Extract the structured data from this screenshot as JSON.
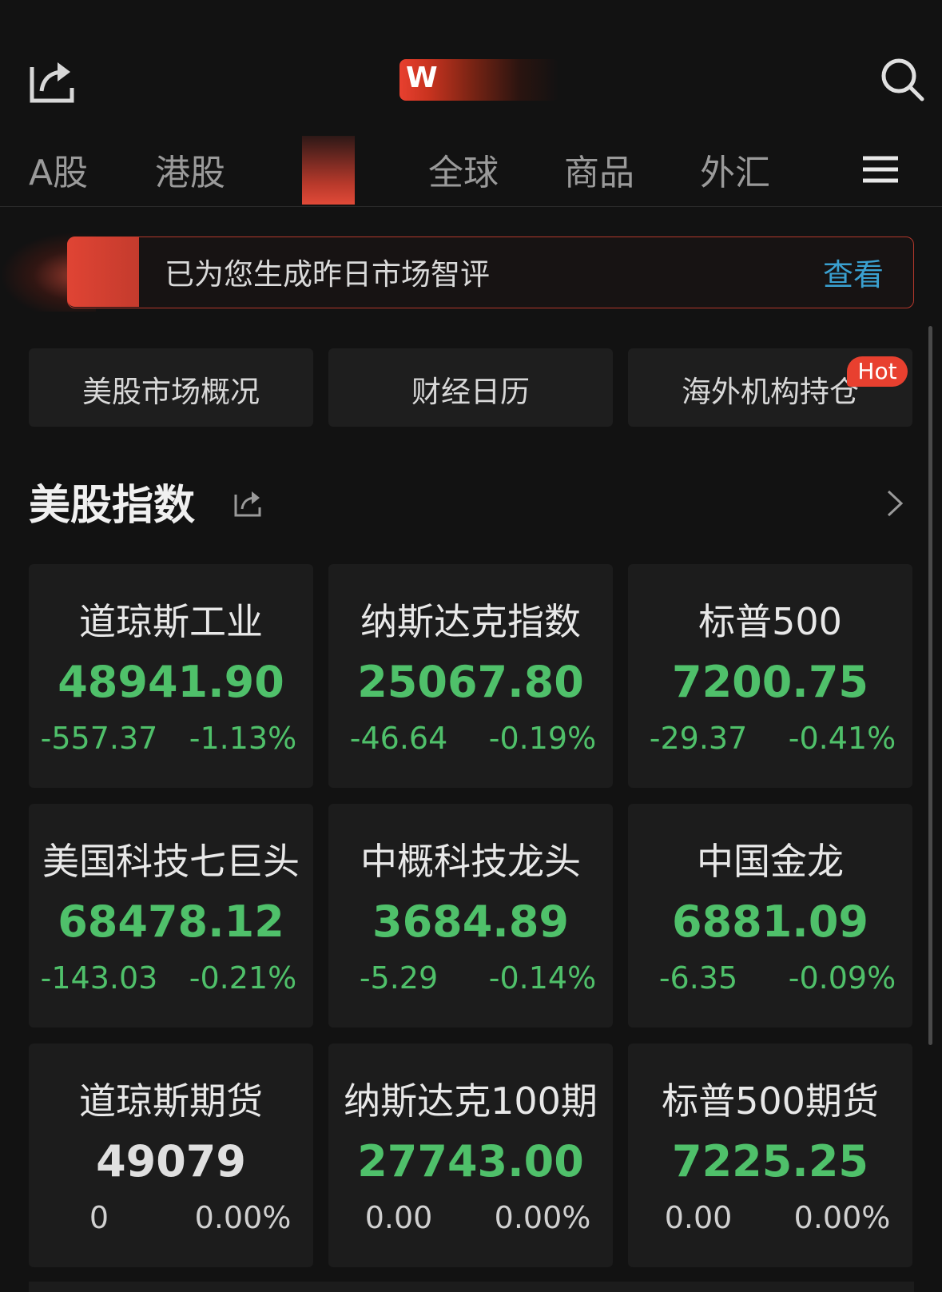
{
  "header": {
    "logo_letter": "W"
  },
  "tabs": [
    {
      "label": "A股"
    },
    {
      "label": "港股"
    },
    {
      "label": ""
    },
    {
      "label": "全球"
    },
    {
      "label": "商品"
    },
    {
      "label": "外汇"
    }
  ],
  "banner": {
    "text": "已为您生成昨日市场智评",
    "link": "查看"
  },
  "quick_links": [
    {
      "label": "美股市场概况"
    },
    {
      "label": "财经日历"
    },
    {
      "label": "海外机构持仓"
    }
  ],
  "hot_badge": "Hot",
  "section": {
    "title": "美股指数"
  },
  "cards": [
    {
      "name": "道琼斯工业",
      "price": "48941.90",
      "change": "-557.37",
      "percent": "-1.13%",
      "trend": "down"
    },
    {
      "name": "纳斯达克指数",
      "price": "25067.80",
      "change": "-46.64",
      "percent": "-0.19%",
      "trend": "down"
    },
    {
      "name": "标普500",
      "price": "7200.75",
      "change": "-29.37",
      "percent": "-0.41%",
      "trend": "down"
    },
    {
      "name": "美国科技七巨头",
      "price": "68478.12",
      "change": "-143.03",
      "percent": "-0.21%",
      "trend": "down"
    },
    {
      "name": "中概科技龙头",
      "price": "3684.89",
      "change": "-5.29",
      "percent": "-0.14%",
      "trend": "down"
    },
    {
      "name": "中国金龙",
      "price": "6881.09",
      "change": "-6.35",
      "percent": "-0.09%",
      "trend": "down"
    },
    {
      "name": "道琼斯期货",
      "price": "49079",
      "change": "0",
      "percent": "0.00%",
      "trend": "flat"
    },
    {
      "name": "纳斯达克100期",
      "price": "27743.00",
      "change": "0.00",
      "percent": "0.00%",
      "trend": "down"
    },
    {
      "name": "标普500期货",
      "price": "7225.25",
      "change": "0.00",
      "percent": "0.00%",
      "trend": "down"
    }
  ],
  "colors": {
    "down": "#4fc06a",
    "accent": "#e8402f",
    "link": "#3aa0d0"
  }
}
